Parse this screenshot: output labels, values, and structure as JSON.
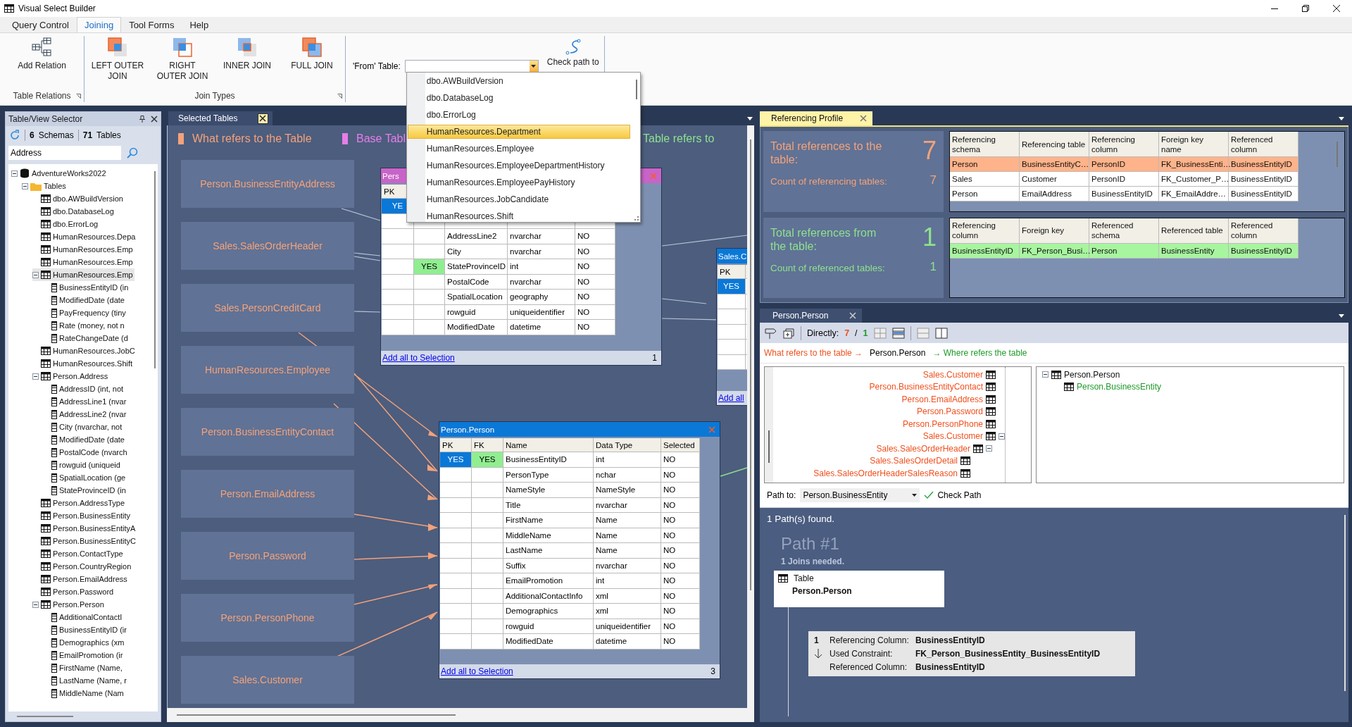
{
  "window": {
    "title": "Visual Select Builder"
  },
  "menu_tabs": [
    {
      "label": "Query Control",
      "selected": false
    },
    {
      "label": "Joining",
      "selected": true
    },
    {
      "label": "Tool Forms",
      "selected": false
    },
    {
      "label": "Help",
      "selected": false
    }
  ],
  "ribbon": {
    "groups": [
      {
        "label": "Table Relations",
        "buttons": [
          {
            "label": "Add Relation",
            "kind": "relation"
          }
        ]
      },
      {
        "label": "Join Types",
        "buttons": [
          {
            "label": "LEFT OUTER JOIN",
            "kind": "left"
          },
          {
            "label": "RIGHT OUTER JOIN",
            "kind": "right"
          },
          {
            "label": "INNER JOIN",
            "kind": "inner"
          },
          {
            "label": "FULL JOIN",
            "kind": "full"
          }
        ]
      }
    ],
    "from_table": {
      "label": "'From' Table:",
      "dropdown": [
        {
          "label": "dbo.AWBuildVersion",
          "selected": false
        },
        {
          "label": "dbo.DatabaseLog",
          "selected": false
        },
        {
          "label": "dbo.ErrorLog",
          "selected": false
        },
        {
          "label": "HumanResources.Department",
          "selected": true
        },
        {
          "label": "HumanResources.Employee",
          "selected": false
        },
        {
          "label": "HumanResources.EmployeeDepartmentHistory",
          "selected": false
        },
        {
          "label": "HumanResources.EmployeePayHistory",
          "selected": false
        },
        {
          "label": "HumanResources.JobCandidate",
          "selected": false
        },
        {
          "label": "HumanResources.Shift",
          "selected": false
        }
      ]
    },
    "check_path": {
      "label": "Check path to"
    }
  },
  "table_selector": {
    "title": "Table/View Selector",
    "schemas_count": "6",
    "schemas_label": "Schemas",
    "tables_count": "71",
    "tables_label": "Tables",
    "search": {
      "value": "Address"
    },
    "tree": [
      {
        "label": "AdventureWorks2022",
        "kind": "database",
        "expanded": true,
        "selected": false,
        "children": [
          {
            "label": "Tables",
            "kind": "folder",
            "expanded": true,
            "selected": false,
            "children": [
              {
                "label": "dbo.AWBuildVersion",
                "kind": "table",
                "selected": false
              },
              {
                "label": "dbo.DatabaseLog",
                "kind": "table",
                "selected": false
              },
              {
                "label": "dbo.ErrorLog",
                "kind": "table",
                "selected": false
              },
              {
                "label": "HumanResources.Depa",
                "kind": "table",
                "selected": false
              },
              {
                "label": "HumanResources.Emp",
                "kind": "table",
                "selected": false
              },
              {
                "label": "HumanResources.Emp",
                "kind": "table",
                "selected": false
              },
              {
                "label": "HumanResources.Emp",
                "kind": "table",
                "expanded": true,
                "selected": true,
                "children": [
                  {
                    "label": "BusinessEntityID (in",
                    "kind": "column",
                    "selected": false
                  },
                  {
                    "label": "ModifiedDate (date",
                    "kind": "column",
                    "selected": false
                  },
                  {
                    "label": "PayFrequency (tiny",
                    "kind": "column",
                    "selected": false
                  },
                  {
                    "label": "Rate (money, not n",
                    "kind": "column",
                    "selected": false
                  },
                  {
                    "label": "RateChangeDate (d",
                    "kind": "column",
                    "selected": false
                  }
                ]
              },
              {
                "label": "HumanResources.JobC",
                "kind": "table",
                "selected": false
              },
              {
                "label": "HumanResources.Shift",
                "kind": "table",
                "selected": false
              },
              {
                "label": "Person.Address",
                "kind": "table",
                "expanded": true,
                "selected": false,
                "children": [
                  {
                    "label": "AddressID (int, not",
                    "kind": "column",
                    "selected": false
                  },
                  {
                    "label": "AddressLine1 (nvar",
                    "kind": "column",
                    "selected": false
                  },
                  {
                    "label": "AddressLine2 (nvar",
                    "kind": "column",
                    "selected": false
                  },
                  {
                    "label": "City (nvarchar, not",
                    "kind": "column",
                    "selected": false
                  },
                  {
                    "label": "ModifiedDate (date",
                    "kind": "column",
                    "selected": false
                  },
                  {
                    "label": "PostalCode (nvarch",
                    "kind": "column",
                    "selected": false
                  },
                  {
                    "label": "rowguid (uniqueid",
                    "kind": "column",
                    "selected": false
                  },
                  {
                    "label": "SpatialLocation (ge",
                    "kind": "column",
                    "selected": false
                  },
                  {
                    "label": "StateProvinceID (in",
                    "kind": "column",
                    "selected": false
                  }
                ]
              },
              {
                "label": "Person.AddressType",
                "kind": "table",
                "selected": false
              },
              {
                "label": "Person.BusinessEntity",
                "kind": "table",
                "selected": false
              },
              {
                "label": "Person.BusinessEntityA",
                "kind": "table",
                "selected": false
              },
              {
                "label": "Person.BusinessEntityC",
                "kind": "table",
                "selected": false
              },
              {
                "label": "Person.ContactType",
                "kind": "table",
                "selected": false
              },
              {
                "label": "Person.CountryRegion",
                "kind": "table",
                "selected": false
              },
              {
                "label": "Person.EmailAddress",
                "kind": "table",
                "selected": false
              },
              {
                "label": "Person.Password",
                "kind": "table",
                "selected": false
              },
              {
                "label": "Person.Person",
                "kind": "table",
                "expanded": true,
                "selected": false,
                "children": [
                  {
                    "label": "AdditionalContactI",
                    "kind": "column",
                    "selected": false
                  },
                  {
                    "label": "BusinessEntityID (ir",
                    "kind": "column",
                    "selected": false
                  },
                  {
                    "label": "Demographics (xm",
                    "kind": "column",
                    "selected": false
                  },
                  {
                    "label": "EmailPromotion (ir",
                    "kind": "column",
                    "selected": false
                  },
                  {
                    "label": "FirstName (Name,",
                    "kind": "column",
                    "selected": false
                  },
                  {
                    "label": "LastName (Name, r",
                    "kind": "column",
                    "selected": false
                  },
                  {
                    "label": "MiddleName (Nam",
                    "kind": "column",
                    "selected": false
                  }
                ]
              }
            ]
          }
        ]
      }
    ]
  },
  "selected_tables": {
    "tab": "Selected Tables",
    "legend": [
      {
        "label": "What refers to the Table",
        "color": "#f4a27a",
        "marker": true
      },
      {
        "label": "Base Tabl",
        "color": "#e67ee6",
        "marker": true
      },
      {
        "label": "Table refers to",
        "color": "#8ee08e",
        "marker": false
      }
    ],
    "referencing_tables": [
      "Person.BusinessEntityAddress",
      "Sales.SalesOrderHeader",
      "Sales.PersonCreditCard",
      "HumanResources.Employee",
      "Person.BusinessEntityContact",
      "Person.EmailAddress",
      "Person.Password",
      "Person.PersonPhone",
      "Sales.Customer"
    ],
    "windows": [
      {
        "title": "Pers",
        "color": "#c864c8",
        "columns": [
          "PK"
        ],
        "rows": [
          {
            "pk": "YE"
          },
          {},
          {
            "name": "AddressLine2",
            "data_type": "nvarchar",
            "selected_value": "NO"
          },
          {
            "name": "City",
            "data_type": "nvarchar",
            "selected_value": "NO"
          },
          {
            "fk": "YES",
            "name": "StateProvinceID",
            "data_type": "int",
            "selected_value": "NO"
          },
          {
            "name": "PostalCode",
            "data_type": "nvarchar",
            "selected_value": "NO"
          },
          {
            "name": "SpatialLocation",
            "data_type": "geography",
            "selected_value": "NO"
          },
          {
            "name": "rowguid",
            "data_type": "uniqueidentifier",
            "selected_value": "NO"
          },
          {
            "name": "ModifiedDate",
            "data_type": "datetime",
            "selected_value": "NO"
          }
        ],
        "link": "Add all to Selection",
        "count": "1"
      },
      {
        "title": "Person.Person",
        "color": "#0a78d7",
        "columns": [
          "PK",
          "FK",
          "Name",
          "Data Type",
          "Selected"
        ],
        "rows": [
          {
            "pk": "YES",
            "fk": "YES",
            "name": "BusinessEntityID",
            "data_type": "int",
            "selected_value": "NO"
          },
          {
            "name": "PersonType",
            "data_type": "nchar",
            "selected_value": "NO"
          },
          {
            "name": "NameStyle",
            "data_type": "NameStyle",
            "selected_value": "NO"
          },
          {
            "name": "Title",
            "data_type": "nvarchar",
            "selected_value": "NO"
          },
          {
            "name": "FirstName",
            "data_type": "Name",
            "selected_value": "NO"
          },
          {
            "name": "MiddleName",
            "data_type": "Name",
            "selected_value": "NO"
          },
          {
            "name": "LastName",
            "data_type": "Name",
            "selected_value": "NO"
          },
          {
            "name": "Suffix",
            "data_type": "nvarchar",
            "selected_value": "NO"
          },
          {
            "name": "EmailPromotion",
            "data_type": "int",
            "selected_value": "NO"
          },
          {
            "name": "AdditionalContactInfo",
            "data_type": "xml",
            "selected_value": "NO"
          },
          {
            "name": "Demographics",
            "data_type": "xml",
            "selected_value": "NO"
          },
          {
            "name": "rowguid",
            "data_type": "uniqueidentifier",
            "selected_value": "NO"
          },
          {
            "name": "ModifiedDate",
            "data_type": "datetime",
            "selected_value": "NO"
          }
        ],
        "link": "Add all to Selection",
        "count": "3"
      },
      {
        "title": "Sales.C",
        "color": "#0a78d7",
        "columns": [
          "PK"
        ],
        "rows": [
          {
            "pk": "YES"
          }
        ],
        "link": "Add all"
      }
    ]
  },
  "referencing_profile": {
    "tab": "Referencing Profile",
    "sections": [
      {
        "kind": "to",
        "title": "Total references to the table:",
        "total": "7",
        "count_label": "Count of referencing tables:",
        "count": "7",
        "columns": [
          "Referencing schema",
          "Referencing table",
          "Referencing column",
          "Foreign key name",
          "Referenced column"
        ],
        "rows": [
          {
            "cells": [
              "Person",
              "BusinessEntityC…",
              "PersonID",
              "FK_BusinessEnti…",
              "BusinessEntityID"
            ],
            "selected": true
          },
          {
            "cells": [
              "Sales",
              "Customer",
              "PersonID",
              "FK_Customer_P…",
              "BusinessEntityID"
            ],
            "selected": false
          },
          {
            "cells": [
              "Person",
              "EmailAddress",
              "BusinessEntityID",
              "FK_EmailAddre…",
              "BusinessEntityID"
            ],
            "selected": false
          }
        ]
      },
      {
        "kind": "from",
        "title": "Total references from the table:",
        "total": "1",
        "count_label": "Count of referenced tables:",
        "count": "1",
        "columns": [
          "Referencing column",
          "Foreign key",
          "Referenced schema",
          "Referenced table",
          "Referenced column"
        ],
        "rows": [
          {
            "cells": [
              "BusinessEntityID",
              "FK_Person_Busi…",
              "Person",
              "BusinessEntity",
              "BusinessEntityID"
            ],
            "selected": true
          }
        ]
      }
    ]
  },
  "person_panel": {
    "tab": "Person.Person",
    "toolbar": {
      "label": "Directly:",
      "to_count": "7",
      "separator": "/",
      "from_count": "1"
    },
    "breadcrumb": {
      "left": "What refers to the table →",
      "center": "Person.Person",
      "right": "→ Where refers the table"
    },
    "referencing_tree": [
      {
        "label": "Sales.Customer"
      },
      {
        "label": "Person.BusinessEntityContact"
      },
      {
        "label": "Person.EmailAddress"
      },
      {
        "label": "Person.Password"
      },
      {
        "label": "Person.PersonPhone"
      },
      {
        "label": "Sales.Customer",
        "expanded": true,
        "children": [
          {
            "label": "Sales.SalesOrderHeader",
            "expanded": true,
            "children": [
              {
                "label": "Sales.SalesOrderDetail"
              },
              {
                "label": "Sales.SalesOrderHeaderSalesReason"
              }
            ]
          }
        ]
      }
    ],
    "referenced_tree": [
      {
        "label": "Person.Person",
        "expanded": true,
        "children": [
          {
            "label": "Person.BusinessEntity"
          }
        ]
      }
    ],
    "path_to": {
      "label": "Path to:",
      "value": "Person.BusinessEntity",
      "button": "Check Path"
    },
    "results": {
      "summary": "1 Path(s) found.",
      "path_title": "Path #1",
      "joins": "1 Joins needed.",
      "table_card": {
        "label": "Table",
        "name": "Person.Person"
      },
      "join": {
        "number": "1",
        "fields": [
          {
            "label": "Referencing Column:",
            "value": "BusinessEntityID"
          },
          {
            "label": "Used Constraint:",
            "value": "FK_Person_BusinessEntity_BusinessEntityID"
          },
          {
            "label": "Referenced Column:",
            "value": "BusinessEntityID"
          }
        ]
      }
    }
  }
}
